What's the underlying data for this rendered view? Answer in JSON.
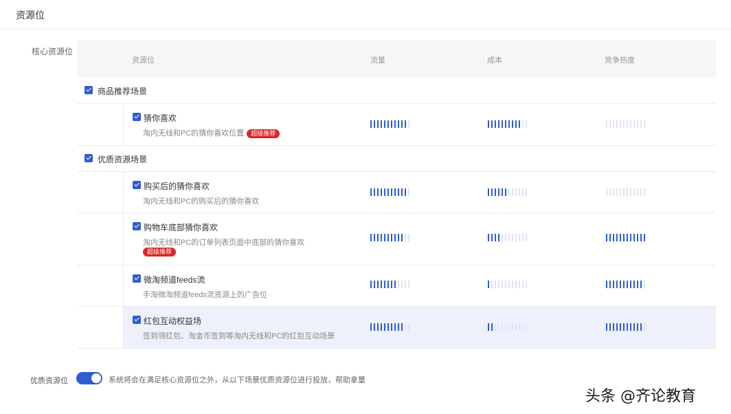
{
  "page": {
    "title": "资源位"
  },
  "section": {
    "label": "核心资源位"
  },
  "table": {
    "headers": [
      "资源位",
      "流量",
      "成本",
      "竞争热度"
    ],
    "groups": [
      {
        "label": "商品推荐场景",
        "items": [
          {
            "title": "猜你喜欢",
            "desc": "淘内无线和PC的猜你喜欢位置",
            "tag": "超级推荐",
            "tag_below": false,
            "levels": [
              0.9,
              0.8,
              0.0
            ]
          }
        ]
      },
      {
        "label": "优质资源场景",
        "items": [
          {
            "title": "购买后的猜你喜欢",
            "desc": "淘内无线和PC的购买后的猜你喜欢",
            "tag": "",
            "tag_below": false,
            "levels": [
              0.9,
              0.5,
              0.0
            ]
          },
          {
            "title": "购物车底部猜你喜欢",
            "desc": "淘内无线和PC的订单列表页面中底部的猜你喜欢",
            "tag": "超级推荐",
            "tag_below": true,
            "levels": [
              0.8,
              0.3,
              1.0
            ]
          },
          {
            "title": "微淘频道feeds流",
            "desc": "手淘微淘频道feeds流资源上的广告位",
            "tag": "",
            "tag_below": false,
            "levels": [
              0.7,
              0.1,
              0.9
            ]
          },
          {
            "title": "红包互动权益场",
            "desc": "签到领红包、淘金币签到等淘内无线和PC的红包互动场景",
            "tag": "",
            "tag_below": false,
            "levels": [
              0.8,
              0.2,
              0.9
            ],
            "highlighted": true
          }
        ]
      }
    ]
  },
  "footer": {
    "label": "优质资源位",
    "toggle_on": true,
    "desc": "系统将会在满足核心资源位之外，从以下场景优质资源位进行投放，帮助拿量"
  },
  "watermark": "头条 @齐论教育",
  "colors": {
    "accent": "#2f5bd3",
    "tag": "#e02424",
    "meter_off": "#dde4f4"
  }
}
